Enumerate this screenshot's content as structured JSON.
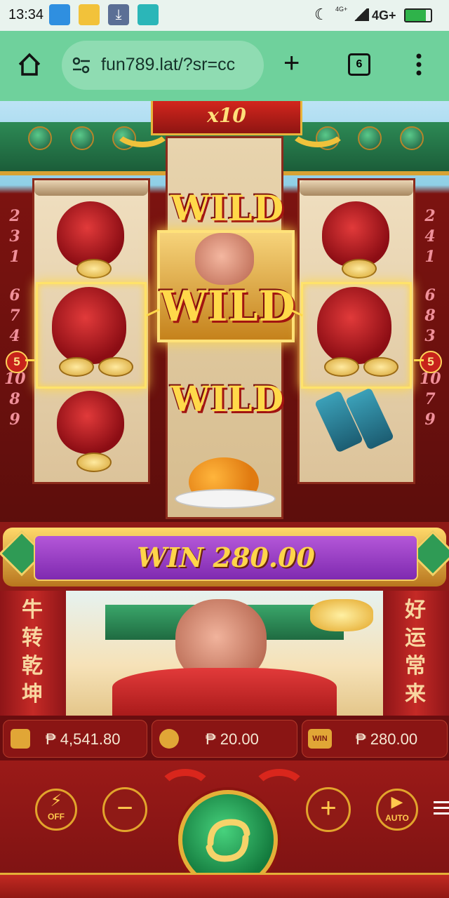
{
  "status_bar": {
    "time": "13:34",
    "network_label": "4G+",
    "network_small": "4G+",
    "icons": [
      "message-icon",
      "folder-icon",
      "download-icon",
      "screenshot-icon",
      "moon-icon",
      "signal-icon",
      "battery-icon"
    ]
  },
  "browser": {
    "url": "fun789.lat/?sr=cc",
    "tab_count": "6"
  },
  "game": {
    "multiplier": "x10",
    "wild_label": "WILD",
    "left_numbers": [
      "2",
      "3",
      "1",
      "6",
      "7",
      "4",
      "5",
      "10",
      "8",
      "9"
    ],
    "right_numbers": [
      "2",
      "4",
      "1",
      "6",
      "8",
      "3",
      "5",
      "10",
      "7",
      "9"
    ],
    "line_badge": "5",
    "win_label": "WIN 280.00",
    "banner_left": [
      "牛",
      "转",
      "乾",
      "坤"
    ],
    "banner_right": [
      "好",
      "运",
      "常",
      "来"
    ],
    "balance": "₱ 4,541.80",
    "bet": "₱ 20.00",
    "win_amount": "₱ 280.00",
    "win_icon_text": "WIN",
    "turbo_label": "OFF",
    "auto_label": "AUTO",
    "minus_label": "−",
    "plus_label": "+"
  },
  "colors": {
    "accent": "#6fd19c",
    "reel_frame": "#8c2b1c",
    "gold": "#ffd54a",
    "purple": "#9a3fcf"
  }
}
